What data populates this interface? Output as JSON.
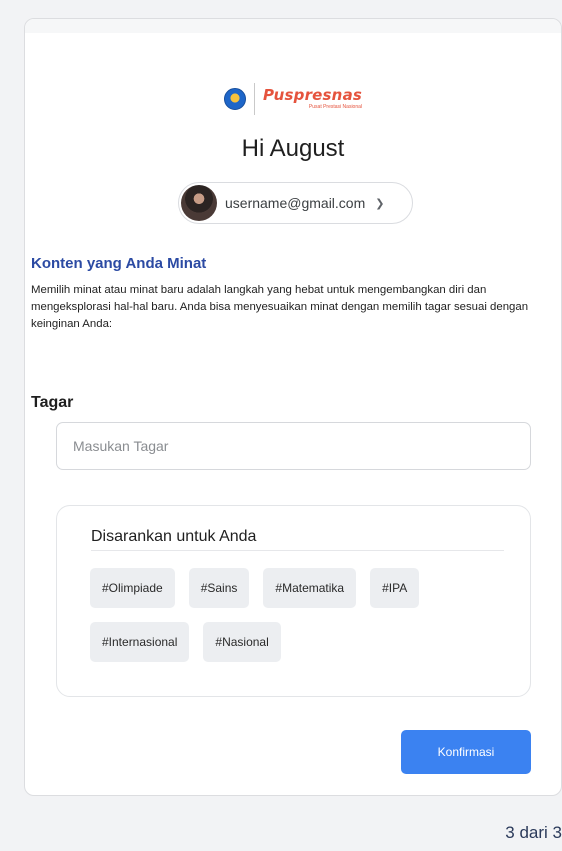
{
  "brand": {
    "name": "Puspresnas",
    "tagline": "Pusat Prestasi Nasional",
    "emblem_icon": "tut-wuri-handayani-emblem-icon"
  },
  "greeting": "Hi August",
  "account": {
    "email": "username@gmail.com",
    "avatar_icon": "user-avatar-icon",
    "chevron_icon": "chevron-down-icon"
  },
  "section": {
    "title": "Konten yang Anda Minat",
    "description": "Memilih minat atau minat baru adalah langkah yang hebat untuk mengembangkan diri dan mengeksplorasi hal-hal baru. Anda bisa menyesuaikan minat dengan memilih tagar sesuai dengan keinginan Anda:"
  },
  "tag_field": {
    "label": "Tagar",
    "placeholder": "Masukan Tagar",
    "value": ""
  },
  "suggestions": {
    "title": "Disarankan untuk Anda",
    "tags": [
      "#Olimpiade",
      "#Sains",
      "#Matematika",
      "#IPA",
      "#Internasional",
      "#Nasional"
    ]
  },
  "confirm_label": "Konfirmasi",
  "pagination": "3 dari 3",
  "colors": {
    "accent": "#3b82f1",
    "section_title": "#2b4aa3",
    "brand": "#e5533d",
    "chip_bg": "#eceef1"
  }
}
